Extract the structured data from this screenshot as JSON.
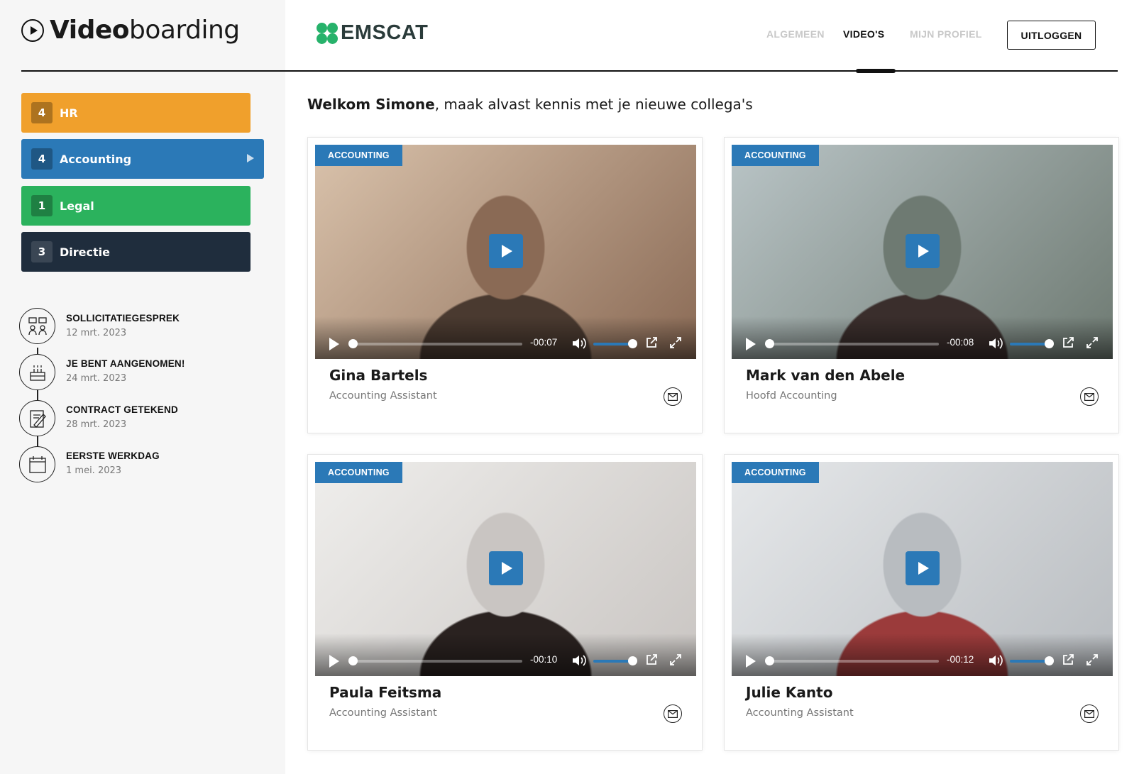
{
  "brand": {
    "bold": "Video",
    "light": "boarding"
  },
  "company": {
    "name": "EMSCAT",
    "logo_color": "#27b26b"
  },
  "nav": {
    "items": [
      {
        "label": "ALGEMEEN",
        "active": false
      },
      {
        "label": "VIDEO'S",
        "active": true
      },
      {
        "label": "MIJN PROFIEL",
        "active": false
      }
    ],
    "logout_label": "UITLOGGEN"
  },
  "categories": [
    {
      "count": "4",
      "label": "HR",
      "color": "#f0a02c",
      "selected": false
    },
    {
      "count": "4",
      "label": "Accounting",
      "color": "#2b79b7",
      "selected": true
    },
    {
      "count": "1",
      "label": "Legal",
      "color": "#2bb25d",
      "selected": false
    },
    {
      "count": "3",
      "label": "Directie",
      "color": "#1f2d3d",
      "selected": false
    }
  ],
  "timeline": [
    {
      "icon": "interview-icon",
      "title": "SOLLICITATIEGESPREK",
      "date": "12 mrt. 2023"
    },
    {
      "icon": "cake-icon",
      "title": "JE BENT AANGENOMEN!",
      "date": "24 mrt. 2023"
    },
    {
      "icon": "contract-icon",
      "title": "CONTRACT GETEKEND",
      "date": "28 mrt. 2023"
    },
    {
      "icon": "calendar-icon",
      "title": "EERSTE WERKDAG",
      "date": "1 mei. 2023"
    }
  ],
  "welcome": {
    "name": "Welkom Simone",
    "rest": ", maak alvast kennis met je nieuwe collega's"
  },
  "videos": [
    {
      "tag": "ACCOUNTING",
      "name": "Gina Bartels",
      "role": "Accounting Assistant",
      "time": "-00:07",
      "thumb_colors": [
        "#8a6a55",
        "#d9c2ab",
        "#4a3a30"
      ]
    },
    {
      "tag": "ACCOUNTING",
      "name": "Mark van den Abele",
      "role": "Hoofd Accounting",
      "time": "-00:08",
      "thumb_colors": [
        "#6e7a72",
        "#b9c4c6",
        "#3a2e2c"
      ]
    },
    {
      "tag": "ACCOUNTING",
      "name": "Paula Feitsma",
      "role": "Accounting Assistant",
      "time": "-00:10",
      "thumb_colors": [
        "#c9c5c2",
        "#efeeec",
        "#2a2220"
      ]
    },
    {
      "tag": "ACCOUNTING",
      "name": "Julie Kanto",
      "role": "Accounting Assistant",
      "time": "-00:12",
      "thumb_colors": [
        "#b8bcc0",
        "#e6e8ea",
        "#9b3b3b"
      ]
    }
  ]
}
